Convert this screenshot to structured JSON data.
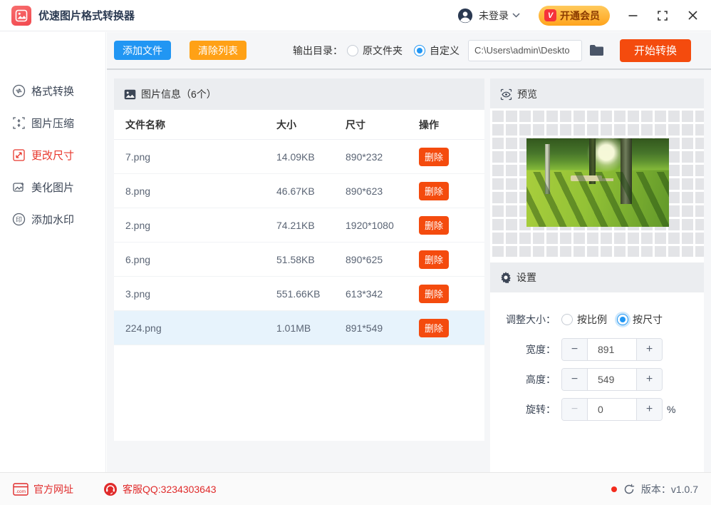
{
  "colors": {
    "accent_blue": "#2196f3",
    "accent_orange": "#ffa116",
    "accent_red": "#f44b0e",
    "footer_red": "#e02b2b",
    "sidebar_active_red": "#e8382d"
  },
  "titlebar": {
    "app_title": "优速图片格式转换器",
    "login_label": "未登录",
    "vip_badge_text": "V",
    "vip_button_label": "开通会员"
  },
  "sidebar": {
    "items": [
      {
        "label": "格式转换",
        "active": false
      },
      {
        "label": "图片压缩",
        "active": false
      },
      {
        "label": "更改尺寸",
        "active": true
      },
      {
        "label": "美化图片",
        "active": false
      },
      {
        "label": "添加水印",
        "active": false
      }
    ]
  },
  "toolbar": {
    "add_files_label": "添加文件",
    "clear_list_label": "清除列表",
    "output_dir_label": "输出目录：",
    "radio_original_folder": "原文件夹",
    "radio_custom": "自定义",
    "output_path_value": "C:\\Users\\admin\\Deskto",
    "start_convert_label": "开始转换"
  },
  "file_panel": {
    "header": "图片信息（6个）",
    "columns": {
      "name": "文件名称",
      "size": "大小",
      "dimensions": "尺寸",
      "operation": "操作"
    },
    "delete_label": "删除",
    "rows": [
      {
        "name": "7.png",
        "size": "14.09KB",
        "dimensions": "890*232",
        "selected": false
      },
      {
        "name": "8.png",
        "size": "46.67KB",
        "dimensions": "890*623",
        "selected": false
      },
      {
        "name": "2.png",
        "size": "74.21KB",
        "dimensions": "1920*1080",
        "selected": false
      },
      {
        "name": "6.png",
        "size": "51.58KB",
        "dimensions": "890*625",
        "selected": false
      },
      {
        "name": "3.png",
        "size": "551.66KB",
        "dimensions": "613*342",
        "selected": false
      },
      {
        "name": "224.png",
        "size": "1.01MB",
        "dimensions": "891*549",
        "selected": true
      }
    ]
  },
  "preview_panel": {
    "header": "预览"
  },
  "settings_panel": {
    "header": "设置",
    "resize_label": "调整大小：",
    "radio_by_ratio": "按比例",
    "radio_by_size": "按尺寸",
    "width_label": "宽度：",
    "width_value": "891",
    "height_label": "高度：",
    "height_value": "549",
    "rotate_label": "旋转：",
    "rotate_value": "0",
    "rotate_unit": "%",
    "minus_label": "−",
    "plus_label": "+"
  },
  "footer": {
    "website_icon_text": ".com",
    "website_label": "官方网址",
    "qq_label": "客服QQ:3234303643",
    "version_label": "版本：v1.0.7"
  }
}
